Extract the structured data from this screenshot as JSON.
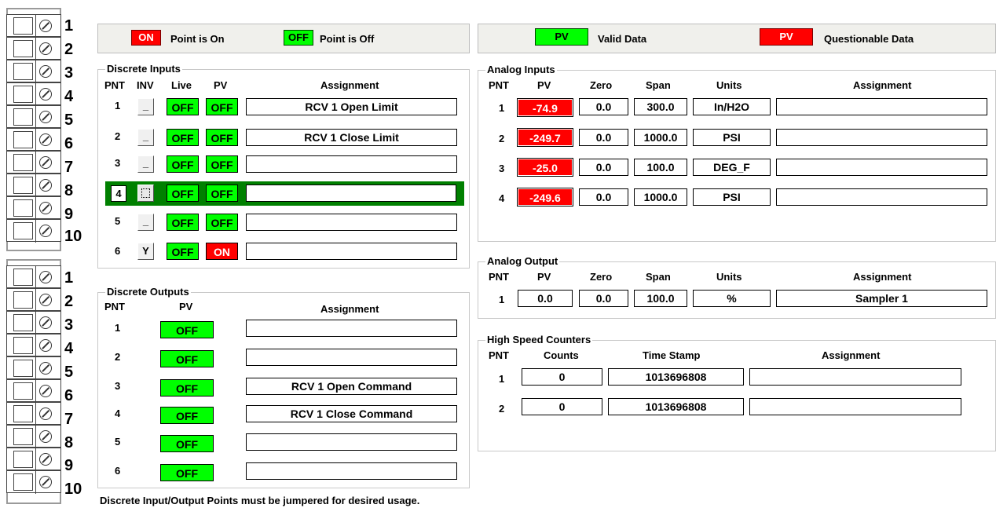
{
  "terminals": {
    "top": [
      "1",
      "2",
      "3",
      "4",
      "5",
      "6",
      "7",
      "8",
      "9",
      "10"
    ],
    "bottom": [
      "1",
      "2",
      "3",
      "4",
      "5",
      "6",
      "7",
      "8",
      "9",
      "10"
    ]
  },
  "legend_left": {
    "on_tag": "ON",
    "on_label": "Point is On",
    "off_tag": "OFF",
    "off_label": "Point is Off"
  },
  "legend_right": {
    "valid_tag": "PV",
    "valid_label": "Valid Data",
    "quest_tag": "PV",
    "quest_label": "Questionable Data"
  },
  "discrete_inputs": {
    "title": "Discrete Inputs",
    "headers": {
      "pnt": "PNT",
      "inv": "INV",
      "live": "Live",
      "pv": "PV",
      "assignment": "Assignment"
    },
    "rows": [
      {
        "pnt": "1",
        "inv": "_",
        "live": "OFF",
        "pv": "OFF",
        "assignment": "RCV 1 Open Limit"
      },
      {
        "pnt": "2",
        "inv": "_",
        "live": "OFF",
        "pv": "OFF",
        "assignment": "RCV 1 Close Limit"
      },
      {
        "pnt": "3",
        "inv": "_",
        "live": "OFF",
        "pv": "OFF",
        "assignment": ""
      },
      {
        "pnt": "4",
        "inv": "",
        "live": "OFF",
        "pv": "OFF",
        "assignment": ""
      },
      {
        "pnt": "5",
        "inv": "_",
        "live": "OFF",
        "pv": "OFF",
        "assignment": ""
      },
      {
        "pnt": "6",
        "inv": "Y",
        "live": "OFF",
        "pv": "ON",
        "assignment": ""
      }
    ]
  },
  "discrete_outputs": {
    "title": "Discrete Outputs",
    "headers": {
      "pnt": "PNT",
      "pv": "PV",
      "assignment": "Assignment"
    },
    "rows": [
      {
        "pnt": "1",
        "pv": "OFF",
        "assignment": ""
      },
      {
        "pnt": "2",
        "pv": "OFF",
        "assignment": ""
      },
      {
        "pnt": "3",
        "pv": "OFF",
        "assignment": "RCV 1 Open Command"
      },
      {
        "pnt": "4",
        "pv": "OFF",
        "assignment": "RCV 1 Close Command"
      },
      {
        "pnt": "5",
        "pv": "OFF",
        "assignment": ""
      },
      {
        "pnt": "6",
        "pv": "OFF",
        "assignment": ""
      }
    ]
  },
  "analog_inputs": {
    "title": "Analog Inputs",
    "headers": {
      "pnt": "PNT",
      "pv": "PV",
      "zero": "Zero",
      "span": "Span",
      "units": "Units",
      "assignment": "Assignment"
    },
    "rows": [
      {
        "pnt": "1",
        "pv": "-74.9",
        "zero": "0.0",
        "span": "300.0",
        "units": "In/H2O",
        "assignment": ""
      },
      {
        "pnt": "2",
        "pv": "-249.7",
        "zero": "0.0",
        "span": "1000.0",
        "units": "PSI",
        "assignment": ""
      },
      {
        "pnt": "3",
        "pv": "-25.0",
        "zero": "0.0",
        "span": "100.0",
        "units": "DEG_F",
        "assignment": ""
      },
      {
        "pnt": "4",
        "pv": "-249.6",
        "zero": "0.0",
        "span": "1000.0",
        "units": "PSI",
        "assignment": ""
      }
    ]
  },
  "analog_output": {
    "title": "Analog Output",
    "headers": {
      "pnt": "PNT",
      "pv": "PV",
      "zero": "Zero",
      "span": "Span",
      "units": "Units",
      "assignment": "Assignment"
    },
    "row": {
      "pnt": "1",
      "pv": "0.0",
      "zero": "0.0",
      "span": "100.0",
      "units": "%",
      "assignment": "Sampler 1"
    }
  },
  "counters": {
    "title": "High Speed Counters",
    "headers": {
      "pnt": "PNT",
      "counts": "Counts",
      "time_stamp": "Time Stamp",
      "assignment": "Assignment"
    },
    "rows": [
      {
        "pnt": "1",
        "counts": "0",
        "time_stamp": "1013696808",
        "assignment": ""
      },
      {
        "pnt": "2",
        "counts": "0",
        "time_stamp": "1013696808",
        "assignment": ""
      }
    ]
  },
  "footer": "Discrete Input/Output Points must be jumpered for desired usage.",
  "colors": {
    "on_red": "#ff0000",
    "off_green": "#00ff00",
    "selected_row": "#008000"
  }
}
